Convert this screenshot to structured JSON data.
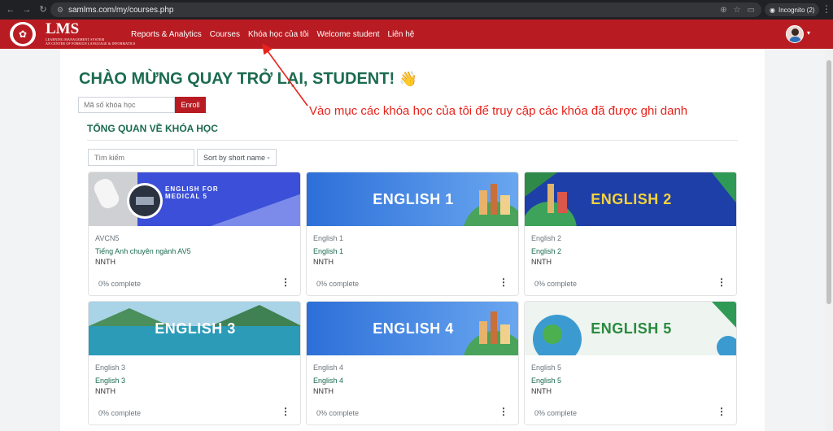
{
  "browser": {
    "url": "samlms.com/my/courses.php",
    "incognito": "Incognito (2)"
  },
  "navbar": {
    "logo_title": "LMS",
    "logo_subtitle_1": "LEARNING MANAGEMENT SYSTEM",
    "logo_subtitle_2": "AN CENTER OF FOREIGN LANGUAGE & INFORMATICS",
    "links": [
      "Reports & Analytics",
      "Courses",
      "Khóa học của tôi",
      "Welcome student",
      "Liên hệ"
    ]
  },
  "page": {
    "welcome": "CHÀO MỪNG QUAY TRỞ LẠI, STUDENT!",
    "wave_emoji": "👋",
    "enroll_placeholder": "Mã số khóa học",
    "enroll_button": "Enroll",
    "annotation": "Vào mục các khóa học của tôi để truy cập các khóa đã được ghi danh",
    "section_title": "TỔNG QUAN VỀ KHÓA HỌC",
    "search_placeholder": "Tìm kiếm",
    "sort_label": "Sort by short name"
  },
  "courses": [
    {
      "banner": "ENGLISH FOR MEDICAL 5",
      "short": "AVCN5",
      "name": "Tiếng Anh chuyên ngành AV5",
      "teacher": "NNTH",
      "progress": "0% complete"
    },
    {
      "banner": "ENGLISH 1",
      "short": "English 1",
      "name": "English 1",
      "teacher": "NNTH",
      "progress": "0% complete"
    },
    {
      "banner": "ENGLISH 2",
      "short": "English 2",
      "name": "English 2",
      "teacher": "NNTH",
      "progress": "0% complete"
    },
    {
      "banner": "ENGLISH 3",
      "short": "English 3",
      "name": "English 3",
      "teacher": "NNTH",
      "progress": "0% complete"
    },
    {
      "banner": "ENGLISH 4",
      "short": "English 4",
      "name": "English 4",
      "teacher": "NNTH",
      "progress": "0% complete"
    },
    {
      "banner": "ENGLISH 5",
      "short": "English 5",
      "name": "English 5",
      "teacher": "NNTH",
      "progress": "0% complete"
    }
  ],
  "colors": {
    "brand_red": "#b81c22",
    "heading_green": "#1b6b4f",
    "annotation_red": "#e8221b"
  }
}
